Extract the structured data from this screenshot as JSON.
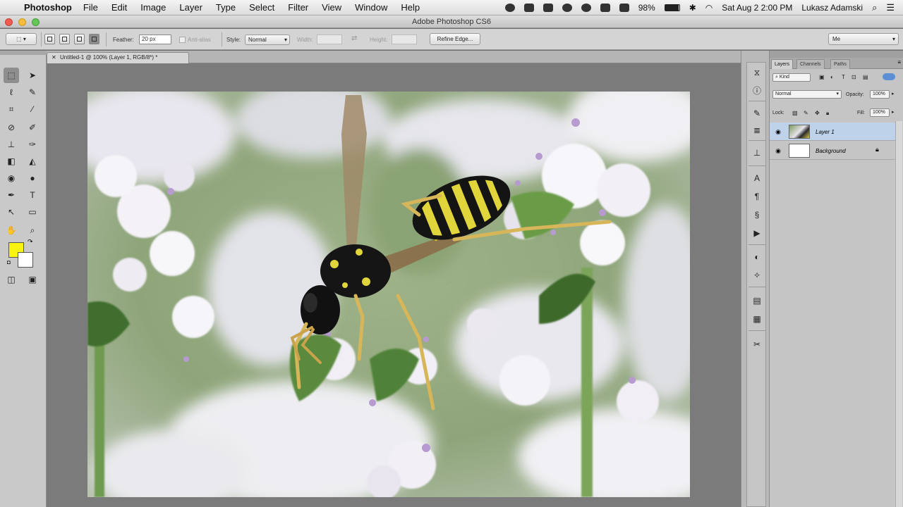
{
  "menubar": {
    "app_name": "Photoshop",
    "menus": [
      "File",
      "Edit",
      "Image",
      "Layer",
      "Type",
      "Select",
      "Filter",
      "View",
      "Window",
      "Help"
    ],
    "battery": "98%",
    "datetime": "Sat Aug 2  2:00 PM",
    "user": "Lukasz Adamski"
  },
  "window": {
    "title": "Adobe Photoshop CS6"
  },
  "options": {
    "feather_label": "Feather:",
    "feather_value": "20 px",
    "antialias_label": "Anti-alias",
    "style_label": "Style:",
    "style_value": "Normal",
    "width_label": "Width:",
    "height_label": "Height:",
    "refine_label": "Refine Edge...",
    "workspace_value": "Me"
  },
  "document": {
    "tab_label": "Untitled-1 @ 100% (Layer 1, RGB/8*) *"
  },
  "tools": {
    "foreground_color": "#f8f410",
    "background_color": "#ffffff"
  },
  "layers_panel": {
    "tabs": [
      "Layers",
      "Channels",
      "Paths"
    ],
    "kind_label": "Kind",
    "blend_mode": "Normal",
    "opacity_label": "Opacity:",
    "opacity_value": "100%",
    "lock_label": "Lock:",
    "fill_label": "Fill:",
    "fill_value": "100%",
    "layers": [
      {
        "name": "Layer 1",
        "selected": true
      },
      {
        "name": "Background",
        "selected": false,
        "locked": true
      }
    ]
  }
}
